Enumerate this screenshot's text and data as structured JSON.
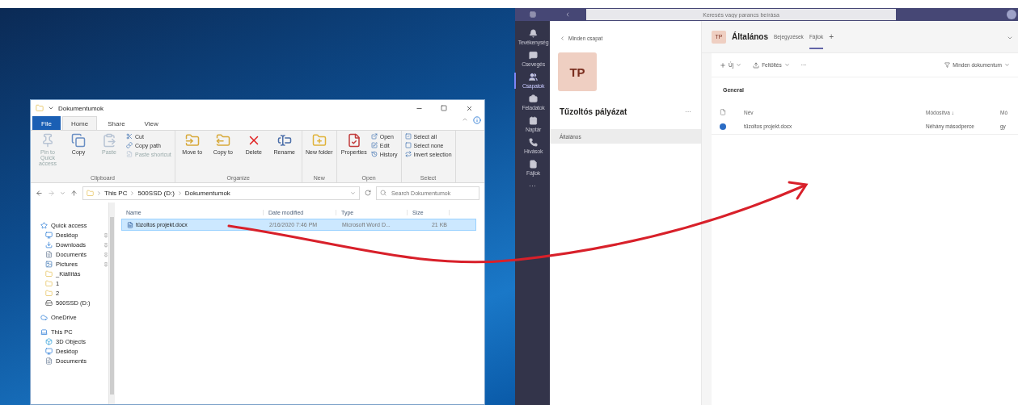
{
  "explorer": {
    "title": "Dokumentumok",
    "tabs": [
      {
        "label": "File",
        "kind": "file",
        "selected": false
      },
      {
        "label": "Home",
        "kind": "tab",
        "selected": true
      },
      {
        "label": "Share",
        "kind": "tab",
        "selected": false
      },
      {
        "label": "View",
        "kind": "tab",
        "selected": false
      }
    ],
    "ribbon_groups": [
      {
        "label": "Clipboard",
        "items": [
          {
            "kind": "large",
            "label": "Pin to Quick access",
            "disabled": true
          },
          {
            "kind": "large",
            "label": "Copy",
            "disabled": false
          },
          {
            "kind": "large",
            "label": "Paste",
            "disabled": true
          },
          {
            "kind": "small",
            "label": "Cut",
            "disabled": false
          },
          {
            "kind": "small",
            "label": "Copy path",
            "disabled": false
          },
          {
            "kind": "small",
            "label": "Paste shortcut",
            "disabled": true
          }
        ]
      },
      {
        "label": "Organize",
        "items": [
          {
            "kind": "large",
            "label": "Move to",
            "disabled": false
          },
          {
            "kind": "large",
            "label": "Copy to",
            "disabled": false
          },
          {
            "kind": "large",
            "label": "Delete",
            "disabled": false
          },
          {
            "kind": "large",
            "label": "Rename",
            "disabled": false
          }
        ]
      },
      {
        "label": "New",
        "items": [
          {
            "kind": "large",
            "label": "New folder",
            "disabled": false
          }
        ]
      },
      {
        "label": "Open",
        "items": [
          {
            "kind": "large",
            "label": "Properties",
            "disabled": false
          },
          {
            "kind": "small",
            "label": "Open",
            "disabled": false
          },
          {
            "kind": "small",
            "label": "Edit",
            "disabled": false
          },
          {
            "kind": "small",
            "label": "History",
            "disabled": false
          }
        ]
      },
      {
        "label": "Select",
        "items": [
          {
            "kind": "small",
            "label": "Select all",
            "disabled": false
          },
          {
            "kind": "small",
            "label": "Select none",
            "disabled": false
          },
          {
            "kind": "small",
            "label": "Invert selection",
            "disabled": false
          }
        ]
      }
    ],
    "path": [
      "This PC",
      "500SSD (D:)",
      "Dokumentumok"
    ],
    "search": {
      "placeholder": "Search Dokumentumok"
    },
    "nav": [
      {
        "label": "Quick access",
        "kind": "star",
        "pinned": false,
        "children": [
          {
            "label": "Desktop",
            "kind": "desktop",
            "pinned": true
          },
          {
            "label": "Downloads",
            "kind": "download",
            "pinned": true
          },
          {
            "label": "Documents",
            "kind": "document",
            "pinned": true
          },
          {
            "label": "Pictures",
            "kind": "picture",
            "pinned": true
          },
          {
            "label": "_Kiállítás",
            "kind": "folder",
            "pinned": false
          },
          {
            "label": "1",
            "kind": "folder",
            "pinned": false
          },
          {
            "label": "2",
            "kind": "folder",
            "pinned": false
          },
          {
            "label": "500SSD (D:)",
            "kind": "drive",
            "pinned": false
          }
        ]
      },
      {
        "label": "OneDrive",
        "kind": "cloud",
        "pinned": false
      },
      {
        "label": "This PC",
        "kind": "pc",
        "pinned": false,
        "children": [
          {
            "label": "3D Objects",
            "kind": "box",
            "pinned": false
          },
          {
            "label": "Desktop",
            "kind": "desktop",
            "pinned": false
          },
          {
            "label": "Documents",
            "kind": "document",
            "pinned": false
          }
        ]
      }
    ],
    "columns": [
      "Name",
      "Date modified",
      "Type",
      "Size"
    ],
    "files": [
      {
        "name": "tüzoltos projekt.docx",
        "modified": "2/16/2020 7:46 PM",
        "type": "Microsoft Word D...",
        "size": "21 KB",
        "selected": true
      }
    ]
  },
  "teams": {
    "search": {
      "placeholder": "Keresés vagy parancs beírása"
    },
    "rail": [
      {
        "label": "Tevékenység",
        "selected": false
      },
      {
        "label": "Csevegés",
        "selected": false
      },
      {
        "label": "Csapatok",
        "selected": true
      },
      {
        "label": "Feladatok",
        "selected": false
      },
      {
        "label": "Naptár",
        "selected": false
      },
      {
        "label": "Hívások",
        "selected": false
      },
      {
        "label": "Fájlok",
        "selected": false
      }
    ],
    "rail_more": "···",
    "back": "Minden csapat",
    "team_initials": "TP",
    "team_name": "Tűzoltós pályázat",
    "team_more": "···",
    "channels": [
      {
        "label": "Általános",
        "selected": true
      }
    ],
    "channel_badge": "TP",
    "channel_title": "Általános",
    "channel_tabs": [
      {
        "label": "Bejegyzések",
        "selected": false
      },
      {
        "label": "Fájlok",
        "selected": true
      }
    ],
    "add_tab": "+",
    "toolbar": [
      {
        "label": "Új",
        "kind": "new"
      },
      {
        "label": "Feltöltés",
        "kind": "upload"
      },
      {
        "label": "···",
        "kind": "more"
      }
    ],
    "view_filter": "Minden dokumentum",
    "folder": "General",
    "columns": [
      "Név",
      "Módosítva ↓",
      "Mó"
    ],
    "files": [
      {
        "name": "tűzoltos projekt.docx",
        "modified": "Néhány másodperce",
        "by": "gy"
      }
    ]
  }
}
